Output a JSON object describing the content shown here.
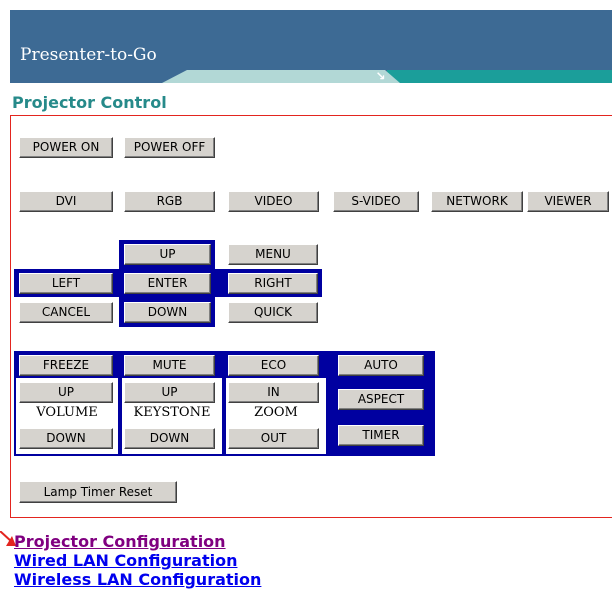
{
  "banner": {
    "title": "Presenter-to-Go"
  },
  "section_heading": "Projector Control",
  "source_buttons": {
    "power_on": "POWER ON",
    "power_off": "POWER OFF",
    "dvi": "DVI",
    "rgb": "RGB",
    "video": "VIDEO",
    "s_video": "S-VIDEO",
    "network": "NETWORK",
    "viewer": "VIEWER"
  },
  "navigation": {
    "up": "UP",
    "menu": "MENU",
    "left": "LEFT",
    "enter": "ENTER",
    "right": "RIGHT",
    "cancel": "CANCEL",
    "down": "DOWN",
    "quick": "QUICK"
  },
  "function_group": {
    "freeze": "FREEZE",
    "mute": "MUTE",
    "eco": "ECO",
    "auto": "AUTO",
    "volume": {
      "label": "VOLUME",
      "up": "UP",
      "down": "DOWN"
    },
    "keystone": {
      "label": "KEYSTONE",
      "up": "UP",
      "down": "DOWN"
    },
    "zoom": {
      "label": "ZOOM",
      "in": "IN",
      "out": "OUT"
    },
    "aspect": "ASPECT",
    "timer": "TIMER"
  },
  "lamp_timer_reset": "Lamp Timer Reset",
  "links": [
    {
      "label": "Projector Configuration",
      "visited": true
    },
    {
      "label": "Wired LAN Configuration",
      "visited": false
    },
    {
      "label": "Wireless LAN Configuration",
      "visited": false
    }
  ],
  "colors": {
    "banner": "#3d6a94",
    "heading": "#268a8a",
    "panel_border": "#e3251f",
    "button_group_background": "#0000a0",
    "link": "#0000ee",
    "visited_link": "#800080",
    "arrow": "#e3251f"
  }
}
